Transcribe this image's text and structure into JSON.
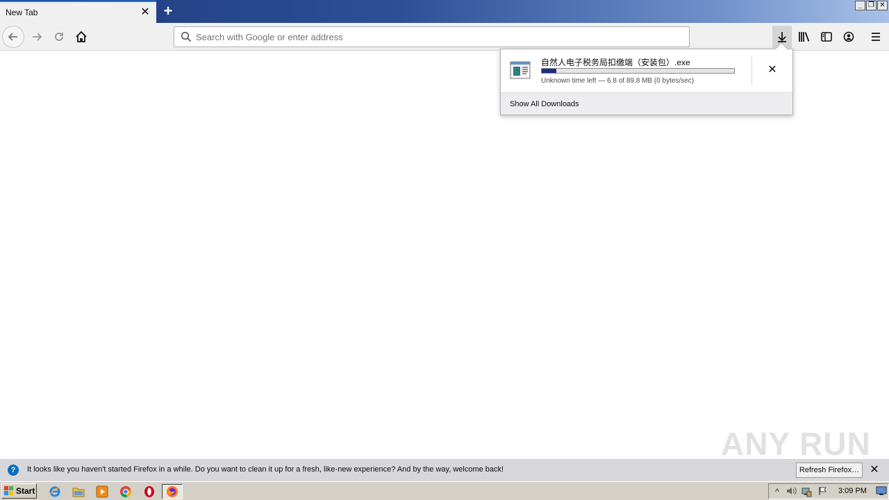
{
  "browser": {
    "tab_title": "New Tab",
    "tab_close": "✕",
    "new_tab": "+",
    "window_buttons": [
      "_",
      "❐",
      "✕"
    ]
  },
  "toolbar": {
    "url_placeholder": "Search with Google or enter address",
    "url_value": ""
  },
  "downloads_panel": {
    "file_name": "自然人电子税务局扣缴端（安装包）.exe",
    "progress_fraction": 0.076,
    "status": "Unknown time left — 6.8 of 89.8 MB (0 bytes/sec)",
    "cancel_label": "✕",
    "show_all_label": "Show All Downloads"
  },
  "notification": {
    "icon": "?",
    "text": "It looks like you haven't started Firefox in a while. Do you want to clean it up for a fresh, like-new experience? And by the way, welcome back!",
    "button_label": "Refresh Firefox…",
    "close_label": "✕"
  },
  "watermark": "ANY RUN",
  "taskbar": {
    "start_label": "Start",
    "apps": [
      "internet-explorer-icon",
      "file-explorer-icon",
      "media-player-icon",
      "chrome-icon",
      "opera-icon",
      "firefox-icon"
    ],
    "clock": "3:09 PM"
  },
  "colors": {
    "titlebar_start": "#1f3a7e",
    "progress_fill": "#1c2f80",
    "notification_bg": "#d7d7db"
  }
}
